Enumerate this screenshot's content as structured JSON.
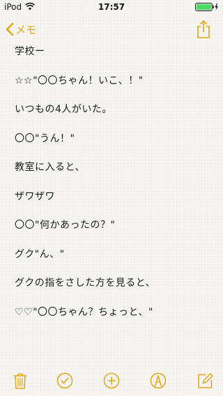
{
  "status_bar": {
    "carrier": "iPod",
    "time": "17:57",
    "battery_color": "#4cd964"
  },
  "nav": {
    "back_label": "メモ",
    "accent_color": "#e2a513",
    "back_icon": "chevron-left-icon",
    "share_icon": "share-icon"
  },
  "note": {
    "lines": [
      "学校ー",
      "☆☆\"〇〇ちゃん！いこ、！\"",
      "いつもの4人がいた。",
      "〇〇\"うん！\"",
      "教室に入ると、",
      "ザワザワ",
      "〇〇\"何かあったの？\"",
      "グク\"ん、\"",
      "グクの指をさした方を見ると、",
      "♡♡\"〇〇ちゃん？ちょっと、\""
    ]
  },
  "toolbar": {
    "icons": [
      "trash-icon",
      "checklist-icon",
      "add-icon",
      "sketch-icon",
      "compose-icon"
    ]
  }
}
